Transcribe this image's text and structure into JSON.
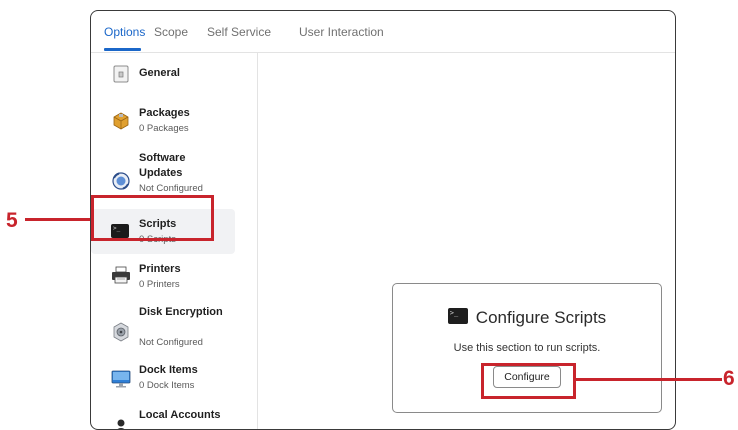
{
  "tabs": [
    {
      "label": "Options",
      "active": true
    },
    {
      "label": "Scope",
      "active": false
    },
    {
      "label": "Self Service",
      "active": false
    },
    {
      "label": "User Interaction",
      "active": false
    }
  ],
  "sidebar": {
    "items": [
      {
        "title": "General",
        "subtitle": "",
        "icon": "lock-icon"
      },
      {
        "title": "Packages",
        "subtitle": "0 Packages",
        "icon": "package-icon"
      },
      {
        "title": "Software Updates",
        "subtitle": "Not Configured",
        "icon": "software-update-icon"
      },
      {
        "title": "Scripts",
        "subtitle": "0 Scripts",
        "icon": "terminal-icon",
        "selected": true
      },
      {
        "title": "Printers",
        "subtitle": "0 Printers",
        "icon": "printer-icon"
      },
      {
        "title": "Disk Encryption",
        "subtitle": "Not Configured",
        "icon": "disk-encryption-icon"
      },
      {
        "title": "Dock Items",
        "subtitle": "0 Dock Items",
        "icon": "dock-icon"
      },
      {
        "title": "Local Accounts",
        "subtitle": "",
        "icon": "user-icon"
      }
    ]
  },
  "card": {
    "title": "Configure Scripts",
    "description": "Use this section to run scripts.",
    "button_label": "Configure",
    "icon": "terminal-icon"
  },
  "callouts": [
    {
      "number": "5"
    },
    {
      "number": "6"
    }
  ],
  "colors": {
    "accent": "#1b67c9",
    "callout": "#c8242c"
  }
}
